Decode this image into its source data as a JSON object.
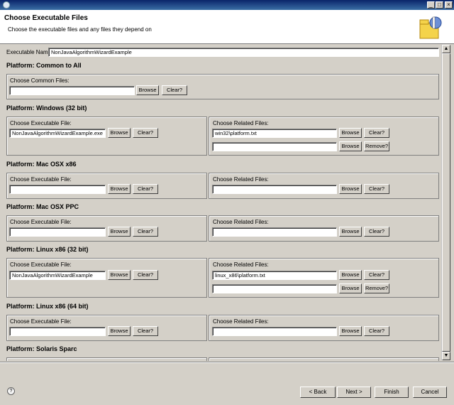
{
  "window": {
    "min_glyph": "_",
    "max_glyph": "□",
    "close_glyph": "×"
  },
  "header": {
    "title": "Choose Executable Files",
    "subtitle": "Choose the executable files and any files they depend on"
  },
  "exec_name": {
    "label": "Executable Name",
    "value": "NonJavaAlgorithmWizardExample"
  },
  "labels": {
    "common_files": "Choose Common Files:",
    "exec_file": "Choose Executable File:",
    "related_files": "Choose Related Files:",
    "browse": "Browse",
    "clear": "Clear?",
    "remove": "Remove?"
  },
  "platforms": {
    "common": "Platform: Common to All",
    "win32": "Platform: Windows (32 bit)",
    "macx86": "Platform: Mac OSX x86",
    "macppc": "Platform: Mac OSX PPC",
    "linux32": "Platform: Linux x86 (32 bit)",
    "linux64": "Platform: Linux x86 (64 bit)",
    "solaris": "Platform: Solaris Sparc"
  },
  "values": {
    "win32_exec": "NonJavaAlgorithmWizardExample.exe",
    "win32_related": "win32\\platform.txt",
    "linux32_exec": "NonJavaAlgorithmWizardExample",
    "linux32_related": "linux_x86\\platform.txt"
  },
  "scroll": {
    "up": "▲",
    "down": "▼"
  },
  "footer": {
    "help": "?",
    "back": "< Back",
    "next": "Next >",
    "finish": "Finish",
    "cancel": "Cancel"
  }
}
